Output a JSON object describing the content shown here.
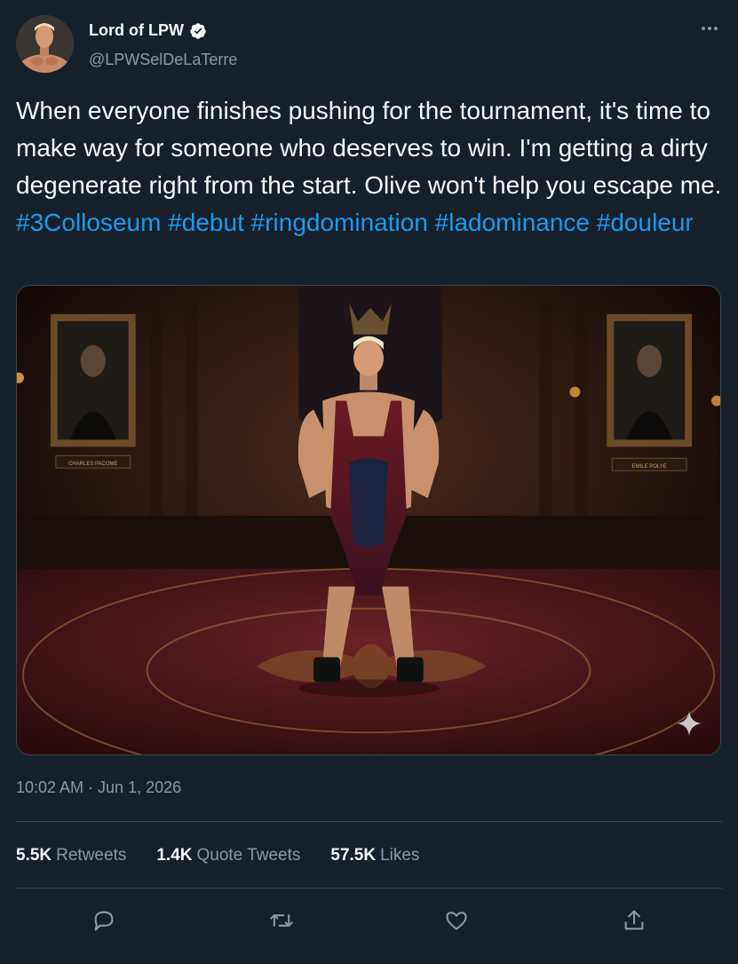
{
  "user": {
    "display_name": "Lord of LPW",
    "handle": "@LPWSelDeLaTerre",
    "verified": true,
    "avatar": "avatar-wrestler"
  },
  "tweet": {
    "text_plain": "When everyone finishes pushing for the tournament, it's time to make way for someone who deserves to win. I'm getting a dirty degenerate right from the start. Olive won't help you escape me. ",
    "hashtags": [
      "#3Colloseum",
      "#debut",
      "#ringdomination",
      "#ladominance",
      "#douleur"
    ],
    "timestamp": "10:02 AM · Jun 1, 2026"
  },
  "media": {
    "portrait_left_caption": "CHARLES PACOME",
    "portrait_right_caption": "EMILE POLYE",
    "sparkle_icon": "sparkle-icon"
  },
  "stats": {
    "retweets_count": "5.5K",
    "retweets_label": "Retweets",
    "quotes_count": "1.4K",
    "quotes_label": "Quote Tweets",
    "likes_count": "57.5K",
    "likes_label": "Likes"
  },
  "icons": {
    "more": "more-icon",
    "reply": "reply-icon",
    "retweet": "retweet-icon",
    "like": "like-icon",
    "share": "share-icon",
    "verified": "verified-badge-icon"
  },
  "colors": {
    "background": "#15202b",
    "text": "#f7f9f9",
    "secondary": "#8b98a5",
    "link": "#1d9bf0",
    "border": "#38444d"
  }
}
